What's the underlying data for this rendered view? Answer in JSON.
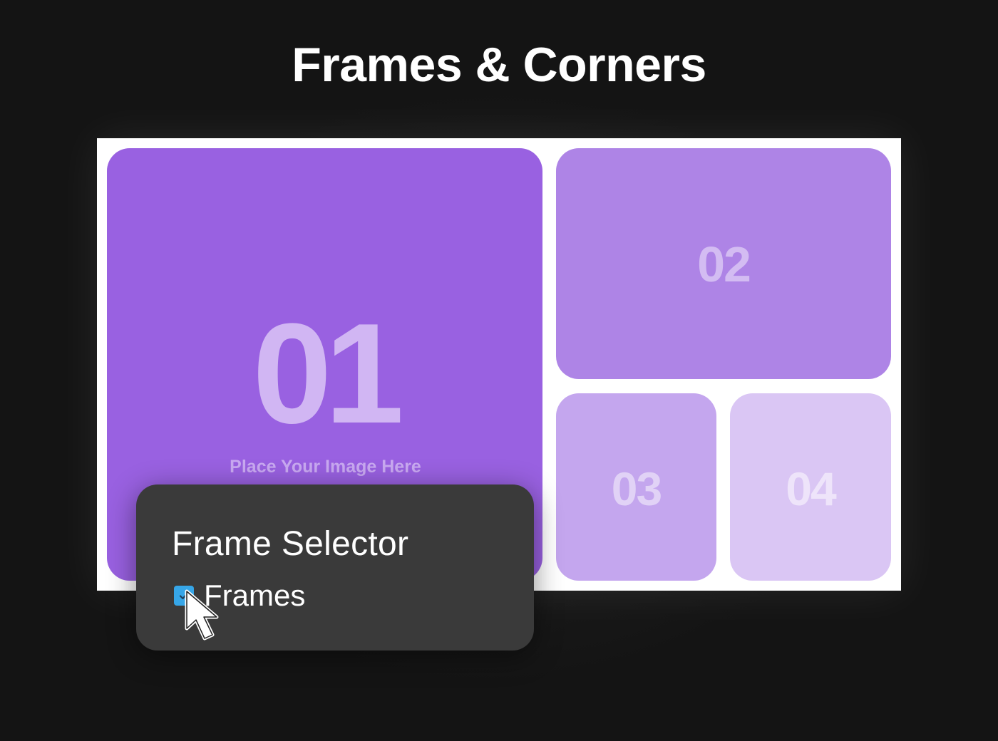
{
  "header": {
    "title": "Frames & Corners"
  },
  "canvas": {
    "frames": [
      {
        "number": "01",
        "caption": "Place Your Image Here",
        "color": "#9961e1"
      },
      {
        "number": "02",
        "color": "#ae84e6"
      },
      {
        "number": "03",
        "color": "#c4a6ee"
      },
      {
        "number": "04",
        "color": "#dac6f4"
      }
    ]
  },
  "panel": {
    "title": "Frame Selector",
    "option": {
      "label": "Frames",
      "checked": true,
      "checkbox_color": "#36a6e8"
    }
  },
  "cursor": {
    "icon": "arrow-pointer-icon"
  }
}
